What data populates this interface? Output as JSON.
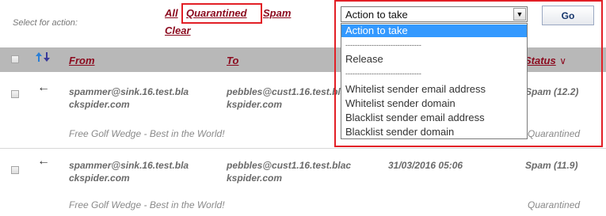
{
  "toolbar": {
    "select_label": "Select for action:",
    "filters": {
      "all": "All",
      "quarantined": "Quarantined",
      "spam": "Spam",
      "clear": "Clear"
    },
    "action_select": {
      "value": "Action to take",
      "options": [
        "Action to take",
        "--------------------------------",
        "Release",
        "--------------------------------",
        "Whitelist sender email address",
        "Whitelist sender domain",
        "Blacklist sender email address",
        "Blacklist sender domain"
      ]
    },
    "go_label": "Go"
  },
  "columns": {
    "sort_icon": "sort-arrows-icon",
    "from": "From",
    "to": "To",
    "status": "Status"
  },
  "rows": [
    {
      "from": [
        "spammer@sink.16.test.bla",
        "ckspider.com"
      ],
      "to": [
        "pebbles@cust1.16.test.blac",
        "kspider.com"
      ],
      "date": "",
      "status": "Spam (12.2)",
      "subject": "Free Golf Wedge - Best in the World!",
      "state": "Quarantined"
    },
    {
      "from": [
        "spammer@sink.16.test.bla",
        "ckspider.com"
      ],
      "to": [
        "pebbles@cust1.16.test.blac",
        "kspider.com"
      ],
      "date": "31/03/2016 05:06",
      "status": "Spam (11.9)",
      "subject": "Free Golf Wedge - Best in the World!",
      "state": "Quarantined"
    }
  ],
  "colors": {
    "link": "#8b0a1e",
    "highlight": "#e21f26",
    "header_bg": "#b8b8b8",
    "selected_option": "#3399ff",
    "sort_up": "#2a7fd6",
    "sort_down": "#3a3a9a"
  }
}
